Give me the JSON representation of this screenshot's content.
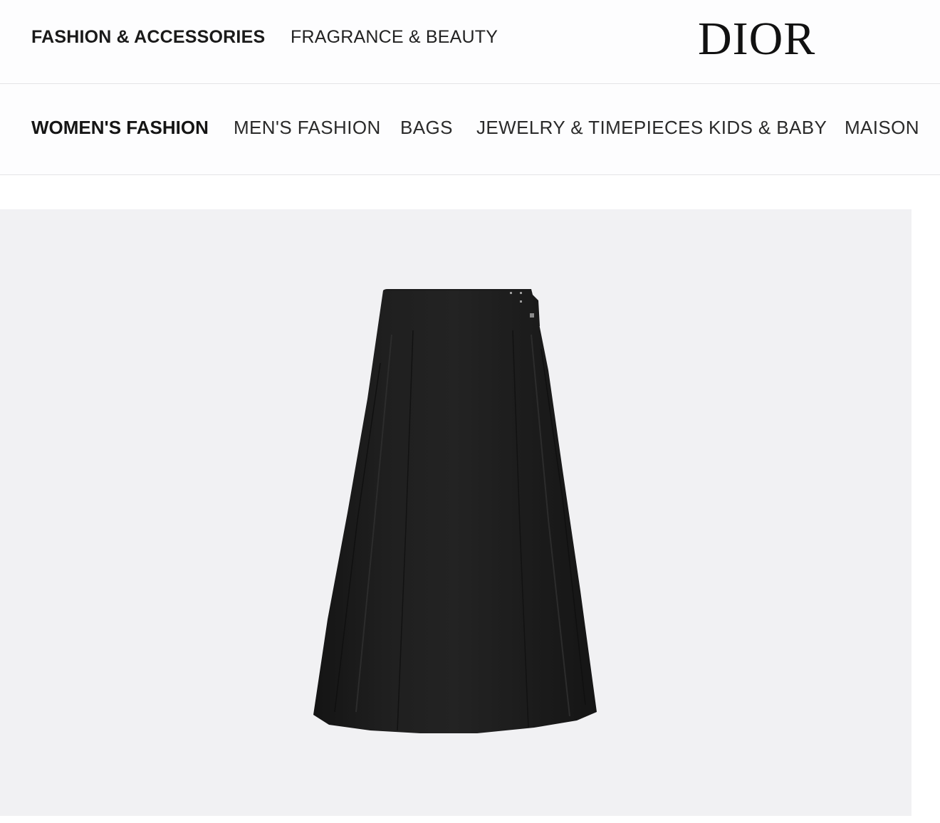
{
  "top_nav": {
    "items": [
      {
        "label": "FASHION & ACCESSORIES",
        "active": true
      },
      {
        "label": "FRAGRANCE & BEAUTY",
        "active": false
      }
    ]
  },
  "brand": {
    "logo_text": "DIOR"
  },
  "category_nav": {
    "items": [
      {
        "label": "WOMEN'S FASHION",
        "active": true
      },
      {
        "label": "MEN'S FASHION",
        "active": false
      },
      {
        "label": "BAGS",
        "active": false
      },
      {
        "label": "JEWELRY & TIMEPIECES",
        "active": false
      },
      {
        "label": "KIDS & BABY",
        "active": false
      },
      {
        "label": "MAISON",
        "active": false
      }
    ]
  },
  "colors": {
    "panel_background": "#f1f1f3",
    "skirt": "#1c1c1c",
    "text": "#1a1a1a"
  }
}
